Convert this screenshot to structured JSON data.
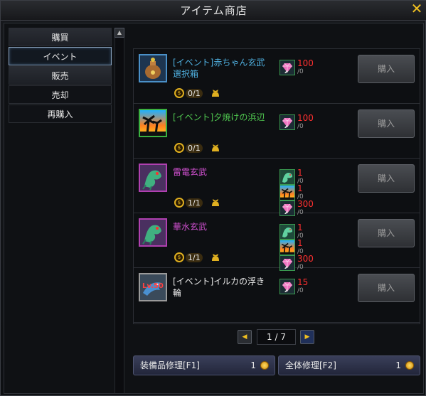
{
  "window": {
    "title": "アイテム商店",
    "close_icon": "close-icon"
  },
  "menu": {
    "items": [
      {
        "label": "購買",
        "type": "header"
      },
      {
        "label": "イベント",
        "type": "selected"
      },
      {
        "label": "販売",
        "type": "header"
      },
      {
        "label": "売却",
        "type": "normal"
      },
      {
        "label": "再購入",
        "type": "normal"
      }
    ]
  },
  "items": [
    {
      "name": "[イベント]赤ちゃん玄武選択箱",
      "name_color": "#4fb0e0",
      "frame": "blue",
      "icon": "treasure-bag-icon",
      "limit": "0/1",
      "costs": [
        {
          "icon": "pink-gem-icon",
          "value": "100",
          "own": "/0"
        }
      ],
      "buy_label": "購入"
    },
    {
      "name": "[イベント]夕焼けの浜辺",
      "name_color": "#50c850",
      "frame": "green",
      "icon": "palm-sunset-icon",
      "limit": "0/1",
      "costs": [
        {
          "icon": "pink-gem-icon",
          "value": "100",
          "own": "/0"
        }
      ],
      "buy_label": "購入"
    },
    {
      "name": "雷電玄武",
      "name_color": "#d050d0",
      "frame": "purple",
      "icon": "dragon-turtle-icon",
      "limit": "1/1",
      "costs": [
        {
          "icon": "dragon-icon",
          "value": "1",
          "own": "/0"
        },
        {
          "icon": "palm-sunset-icon",
          "value": "1",
          "own": "/0"
        },
        {
          "icon": "pink-gem-icon",
          "value": "300",
          "own": "/0"
        }
      ],
      "buy_label": "購入"
    },
    {
      "name": "華水玄武",
      "name_color": "#d050d0",
      "frame": "purple",
      "icon": "dragon-turtle-icon",
      "limit": "1/1",
      "costs": [
        {
          "icon": "dragon-icon",
          "value": "1",
          "own": "/0"
        },
        {
          "icon": "palm-sunset-icon",
          "value": "1",
          "own": "/0"
        },
        {
          "icon": "pink-gem-icon",
          "value": "300",
          "own": "/0"
        }
      ],
      "buy_label": "購入"
    },
    {
      "name": "[イベント]イルカの浮き輪",
      "name_color": "#e8e8e8",
      "frame": "grey",
      "icon": "dolphin-float-icon",
      "icon_label": "Lv.50",
      "limit": "",
      "costs": [
        {
          "icon": "pink-gem-icon",
          "value": "15",
          "own": "/0"
        }
      ],
      "buy_label": "購入"
    }
  ],
  "pager": {
    "text": "1 / 7"
  },
  "repair": {
    "equipped_label": "装備品修理[F1]",
    "equipped_cost": "1",
    "all_label": "全体修理[F2]",
    "all_cost": "1"
  },
  "colors": {
    "cost_red": "#ff3030",
    "gold": "#f0c020"
  }
}
